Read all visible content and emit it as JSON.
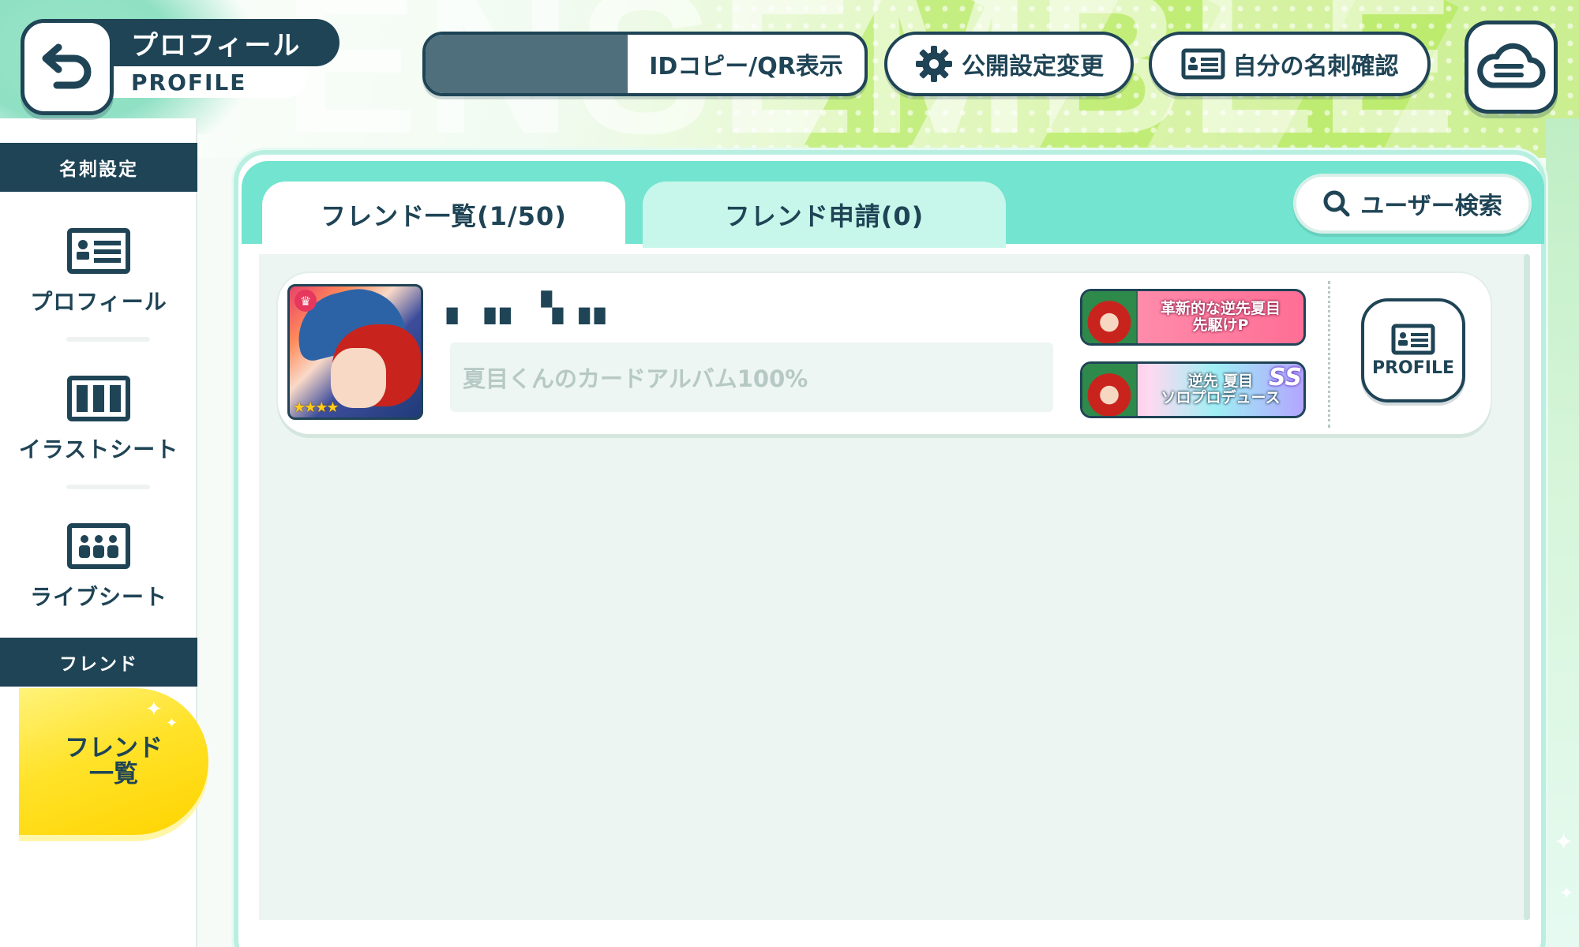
{
  "header": {
    "title": "プロフィール",
    "subtitle": "PROFILE",
    "back_icon": "back-arrow-icon",
    "id_copy_label": "IDコピー/QR表示",
    "privacy_label": "公開設定変更",
    "my_card_label": "自分の名刺確認",
    "cloud_icon": "cloud-menu-icon"
  },
  "background": {
    "watermark": "ENSEMBLE"
  },
  "sidebar": {
    "section_card": "名刺設定",
    "items": [
      {
        "label": "プロフィール",
        "icon": "profile-card-icon"
      },
      {
        "label": "イラストシート",
        "icon": "illust-sheet-icon"
      },
      {
        "label": "ライブシート",
        "icon": "live-sheet-icon"
      }
    ],
    "section_friend": "フレンド",
    "active_item_line1": "フレンド",
    "active_item_line2": "一覧"
  },
  "tabs": {
    "friend_list": "フレンド一覧(1/50)",
    "friend_requests": "フレンド申請(0)",
    "user_search": "ユーザー検索"
  },
  "friends": [
    {
      "name": "▖▗▖ ▚▗▖",
      "comment": "夏目くんのカードアルバム100%",
      "badge_1": "革新的な逆先夏目\n先駆けP",
      "badge_2": "逆先 夏目\nソロプロデュース",
      "badge_2_rank": "SS",
      "profile_button": "PROFILE"
    }
  ],
  "colors": {
    "navy": "#1f4456",
    "tab_bar": "#72e4cf",
    "active_sidebar": "#ffd400",
    "list_bg": "#ecf5f1"
  }
}
